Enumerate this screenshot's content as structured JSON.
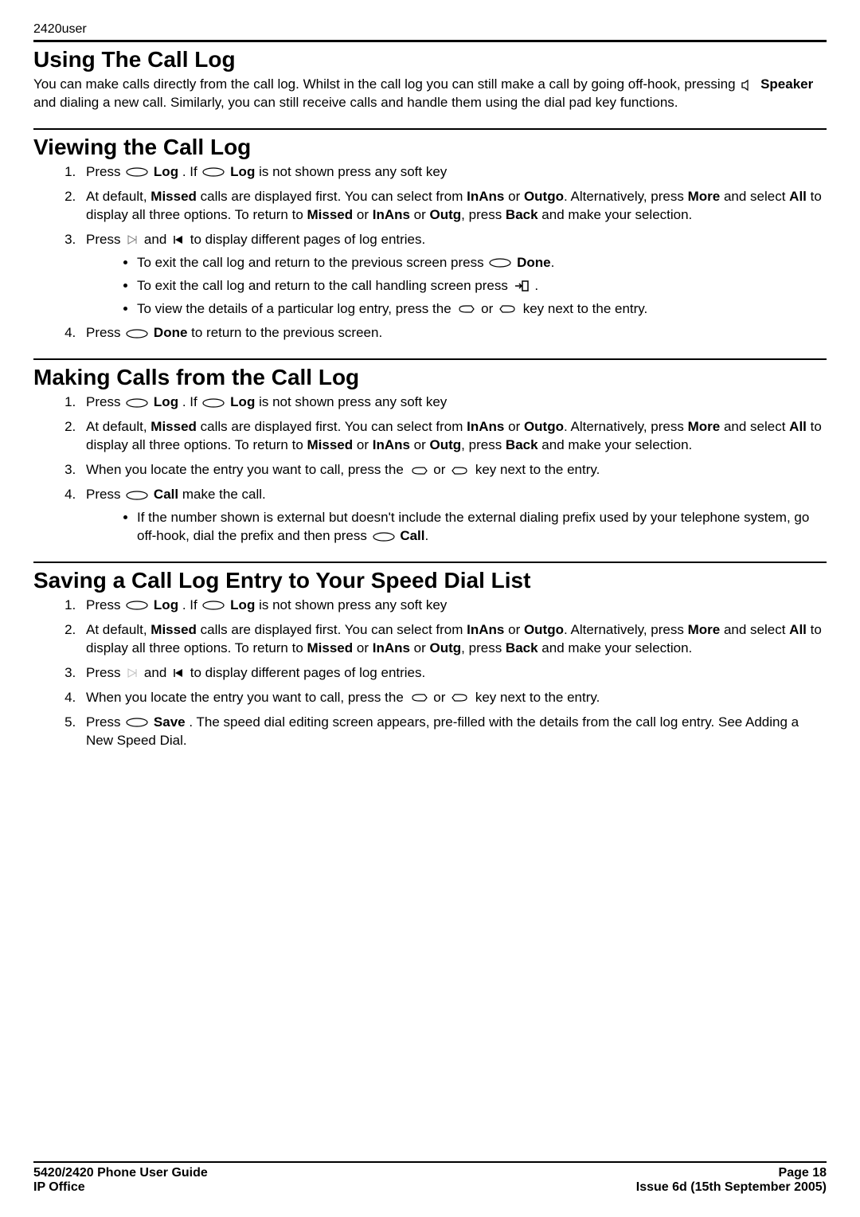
{
  "header": {
    "model": "2420user"
  },
  "sections": {
    "using_call_log": {
      "title": "Using The Call Log",
      "intro_1": "You can make calls directly from the call log. Whilst in the call log you can still make a call by going off-hook, pressing ",
      "speaker_label": "Speaker",
      "intro_2": " and dialing a new call. Similarly, you can still receive calls and handle them using the dial pad key functions."
    },
    "viewing_call_log": {
      "title": "Viewing the Call Log",
      "step1_a": "Press ",
      "step1_log": "Log",
      "step1_b": ". If ",
      "step1_c": " is not shown press any soft key",
      "step2_a": "At default, ",
      "step2_missed": "Missed",
      "step2_b": " calls are displayed first. You can select from ",
      "step2_inans": "InAns",
      "step2_or1": " or ",
      "step2_outgo": "Outgo",
      "step2_c": ". Alternatively, press ",
      "step2_more": "More",
      "step2_d": " and select ",
      "step2_all": "All",
      "step2_e": " to display all three options. To return to ",
      "step2_f": " or ",
      "step2_g": " or ",
      "step2_outg": "Outg",
      "step2_h": ", press ",
      "step2_back": "Back",
      "step2_i": " and make your selection.",
      "step3_a": "Press ",
      "step3_b": " and ",
      "step3_c": " to display different pages of log entries.",
      "bullet1_a": "To exit the call log and return to the previous screen press ",
      "bullet1_done": "Done",
      "bullet1_b": ".",
      "bullet2_a": "To exit the call log and return to the call handling screen press ",
      "bullet2_b": ".",
      "bullet3_a": "To view the details of a particular log entry, press the ",
      "bullet3_b": " or ",
      "bullet3_c": " key next to the entry.",
      "step4_a": "Press ",
      "step4_done": "Done",
      "step4_b": " to return to the previous screen."
    },
    "making_calls": {
      "title": "Making Calls from the Call Log",
      "step3_a": "When you locate the entry you want to call, press the ",
      "step3_b": " or ",
      "step3_c": " key next to the entry.",
      "step4_a": "Press ",
      "step4_call": "Call",
      "step4_b": " make the call.",
      "bullet_a": "If the number shown is external but doesn't include the external dialing prefix used by your telephone system, go off-hook, dial the prefix and then press ",
      "bullet_b": "."
    },
    "saving_entry": {
      "title": "Saving a Call Log Entry to Your Speed Dial List",
      "step4_a": "When you locate the entry you want to call, press the ",
      "step4_b": " or ",
      "step4_c": " key next to the entry.",
      "step5_a": "Press ",
      "step5_save": "Save",
      "step5_b": ". The speed dial editing screen appears, pre-filled with the details from the call log entry. See Adding a New Speed Dial."
    }
  },
  "footer": {
    "left1": "5420/2420 Phone User Guide",
    "left2": "IP Office",
    "right1": "Page 18",
    "right2": "Issue 6d (15th September 2005)"
  }
}
